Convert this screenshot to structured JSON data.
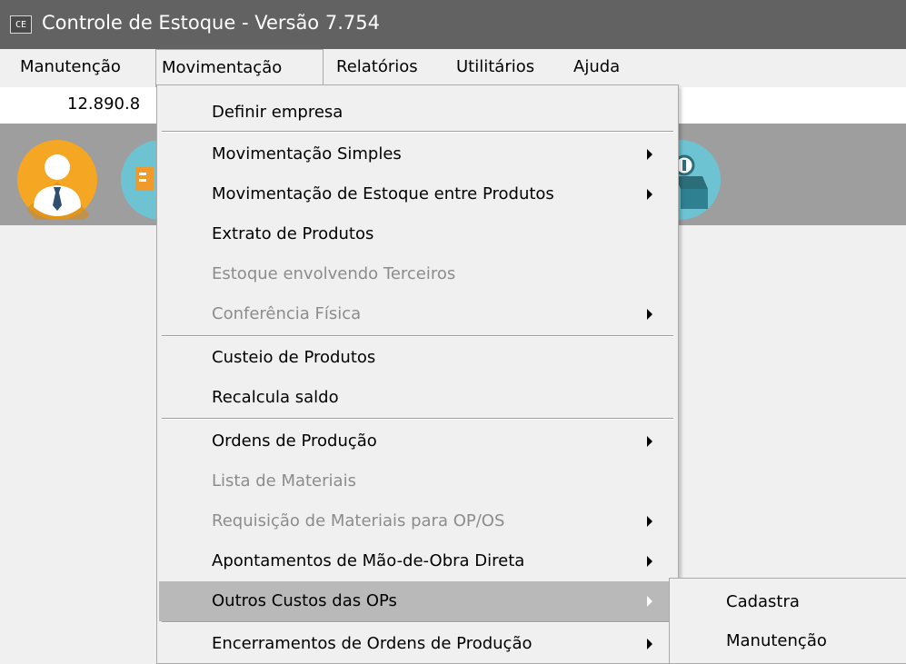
{
  "window": {
    "app_icon_text": "CE",
    "title": "Controle de Estoque - Versão 7.754"
  },
  "menubar": {
    "items": [
      "Manutenção",
      "Movimentação",
      "Relatórios",
      "Utilitários",
      "Ajuda"
    ],
    "open_item": "Movimentação"
  },
  "infobar": {
    "value": "12.890.8"
  },
  "toolbar": {
    "buttons": [
      {
        "icon": "user-person-icon",
        "color": "#f5a623"
      },
      {
        "icon": "delivery-truck-icon",
        "color": "#6ec3d3"
      },
      {
        "icon": "money-box-icon",
        "color": "#6ec3d3"
      }
    ]
  },
  "menu": {
    "items": [
      {
        "label": "Definir empresa",
        "enabled": true,
        "submenu": false
      },
      {
        "label": "Movimentação Simples",
        "enabled": true,
        "submenu": true
      },
      {
        "label": "Movimentação de Estoque entre Produtos",
        "enabled": true,
        "submenu": true
      },
      {
        "label": "Extrato de Produtos",
        "enabled": true,
        "submenu": false
      },
      {
        "label": "Estoque envolvendo Terceiros",
        "enabled": false,
        "submenu": false
      },
      {
        "label": "Conferência Física",
        "enabled": false,
        "submenu": true
      },
      {
        "label": "Custeio de Produtos",
        "enabled": true,
        "submenu": false
      },
      {
        "label": "Recalcula saldo",
        "enabled": true,
        "submenu": false
      },
      {
        "label": "Ordens de Produção",
        "enabled": true,
        "submenu": true
      },
      {
        "label": "Lista de Materiais",
        "enabled": false,
        "submenu": false
      },
      {
        "label": "Requisição de Materiais para OP/OS",
        "enabled": false,
        "submenu": true
      },
      {
        "label": "Apontamentos de Mão-de-Obra Direta",
        "enabled": true,
        "submenu": true
      },
      {
        "label": "Outros Custos das OPs",
        "enabled": true,
        "submenu": true,
        "highlighted": true
      },
      {
        "label": "Encerramentos de Ordens de Produção",
        "enabled": true,
        "submenu": true
      }
    ]
  },
  "submenu": {
    "items": [
      "Cadastra",
      "Manutenção"
    ]
  },
  "colors": {
    "titlebar": "#626262",
    "toolbar": "#9e9e9e",
    "highlight": "#b9b9b9",
    "disabled_text": "#8c8c8c"
  }
}
